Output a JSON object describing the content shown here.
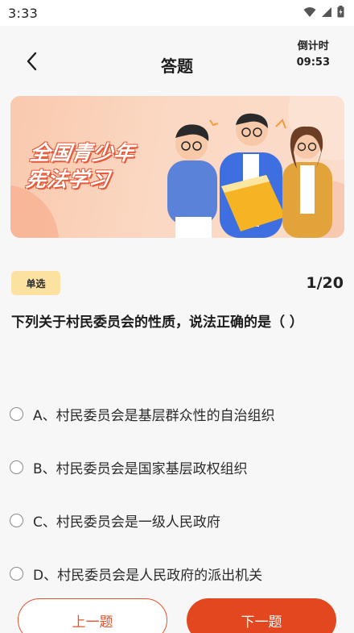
{
  "status_bar": {
    "time": "3:33"
  },
  "header": {
    "title": "答题",
    "countdown_label": "倒计时",
    "countdown_value": "09:53"
  },
  "banner": {
    "line1": "全国青少年",
    "line2": "宪法学习"
  },
  "question": {
    "type_badge": "单选",
    "progress": "1/20",
    "text": "下列关于村民委员会的性质，说法正确的是（  ）",
    "options": [
      {
        "label": "A、村民委员会是基层群众性的自治组织",
        "selected": false
      },
      {
        "label": "B、村民委员会是国家基层政权组织",
        "selected": false
      },
      {
        "label": "C、村民委员会是一级人民政府",
        "selected": false
      },
      {
        "label": "D、村民委员会是人民政府的派出机关",
        "selected": false
      }
    ]
  },
  "footer": {
    "prev_label": "上一题",
    "next_label": "下一题"
  },
  "colors": {
    "accent": "#e2471f",
    "badge_bg": "#fbe2a0",
    "banner_bg": "#fbd8c3"
  }
}
